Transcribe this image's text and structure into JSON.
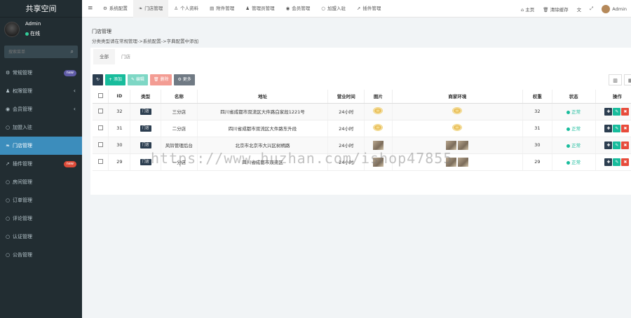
{
  "sidebar": {
    "brand": "共享空间",
    "user": {
      "name": "Admin",
      "status": "在线"
    },
    "search": {
      "placeholder": "搜索菜单"
    },
    "items": [
      {
        "label": "常规管理",
        "icon": "gears-icon",
        "badge": "new",
        "badge_color": "#605ca8"
      },
      {
        "label": "权限管理",
        "icon": "group-icon",
        "chevron": "‹"
      },
      {
        "label": "会员管理",
        "icon": "user-circle-icon",
        "chevron": "‹"
      },
      {
        "label": "加盟入驻",
        "icon": "circle-icon"
      },
      {
        "label": "门店管理",
        "icon": "leaf-icon",
        "active": true
      },
      {
        "label": "插件管理",
        "icon": "rocket-icon",
        "badge": "new",
        "badge_color": "#dd4b39"
      },
      {
        "label": "房间管理",
        "icon": "circle-icon"
      },
      {
        "label": "订单管理",
        "icon": "circle-icon"
      },
      {
        "label": "评论管理",
        "icon": "circle-icon"
      },
      {
        "label": "认证管理",
        "icon": "circle-icon"
      },
      {
        "label": "公告管理",
        "icon": "circle-icon"
      }
    ]
  },
  "topnav": {
    "tabs": [
      {
        "label": "系统配置",
        "icon": "gear-icon"
      },
      {
        "label": "门店管理",
        "icon": "leaf-icon",
        "active": true
      },
      {
        "label": "个人资料",
        "icon": "user-icon"
      },
      {
        "label": "附件管理",
        "icon": "file-icon"
      },
      {
        "label": "管理员管理",
        "icon": "admin-icon"
      },
      {
        "label": "会员管理",
        "icon": "user-circle-icon"
      },
      {
        "label": "加盟入驻",
        "icon": "circle-icon"
      },
      {
        "label": "插件管理",
        "icon": "rocket-icon"
      }
    ],
    "right": {
      "home": "主页",
      "clear_cache": "清除缓存",
      "user": "Admin"
    }
  },
  "page": {
    "title": "门店管理",
    "description": "分类类型请在常规管理->系统配置->字典配置中添加",
    "subtabs": [
      "全部",
      "门店"
    ]
  },
  "toolbar": {
    "add": "添加",
    "edit": "编辑",
    "delete": "删除",
    "more": "更多"
  },
  "table": {
    "headers": [
      "ID",
      "类型",
      "名称",
      "地址",
      "营业时间",
      "图片",
      "商家环境",
      "权重",
      "状态",
      "操作"
    ],
    "rows": [
      {
        "id": "32",
        "type": "门店",
        "name": "三分店",
        "address": "四川省成都市双流区大件路白家段1221号",
        "hours": "24小时",
        "image": "logo",
        "env": "logo",
        "weight": "32",
        "status": "正常"
      },
      {
        "id": "31",
        "type": "门店",
        "name": "二分店",
        "address": "四川省成都市双流区大件路东升段",
        "hours": "24小时",
        "image": "logo",
        "env": "logo",
        "weight": "31",
        "status": "正常"
      },
      {
        "id": "30",
        "type": "门店",
        "name": "风铃管理后台",
        "address": "北京市北京市大兴区树柄路",
        "hours": "24小时",
        "image": "photo",
        "env": "photos",
        "weight": "30",
        "status": "正常"
      },
      {
        "id": "29",
        "type": "门店",
        "name": "一分店",
        "address": "四川省成都市双流区",
        "hours": "24小时",
        "image": "photo",
        "env": "photos",
        "weight": "29",
        "status": "正常"
      }
    ]
  },
  "watermark": "https://www.huzhan.com/ishop47855",
  "colors": {
    "accent": "#3c8dbc",
    "sidebar": "#222d32",
    "success": "#18bc9c",
    "danger": "#e74c3c"
  }
}
